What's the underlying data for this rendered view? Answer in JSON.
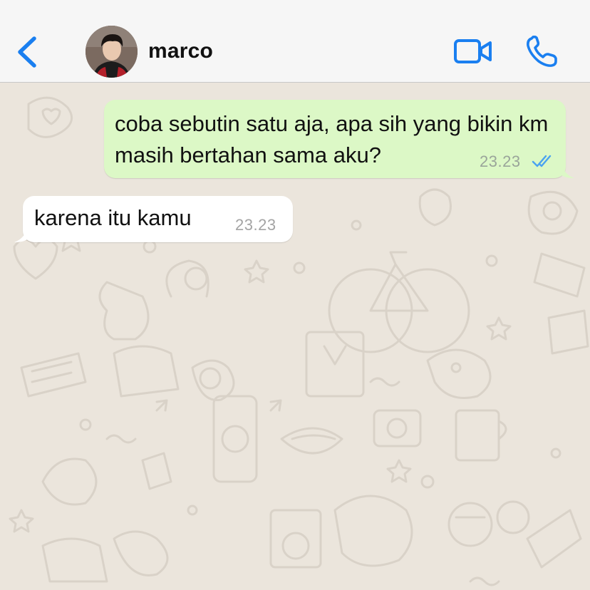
{
  "header": {
    "contact_name": "marco",
    "back_icon": "chevron-left-icon",
    "video_icon": "video-camera-icon",
    "call_icon": "phone-icon",
    "accent_color": "#1a7ff0"
  },
  "messages": [
    {
      "direction": "outgoing",
      "text": "coba sebutin satu aja, apa sih yang bikin km masih bertahan sama aku?",
      "time": "23.23",
      "status": "read",
      "bubble_color": "#dcf8c6",
      "status_color": "#4aa3f0"
    },
    {
      "direction": "incoming",
      "text": "karena itu kamu",
      "time": "23.23",
      "bubble_color": "#ffffff"
    }
  ],
  "background_color": "#ebe5dc"
}
